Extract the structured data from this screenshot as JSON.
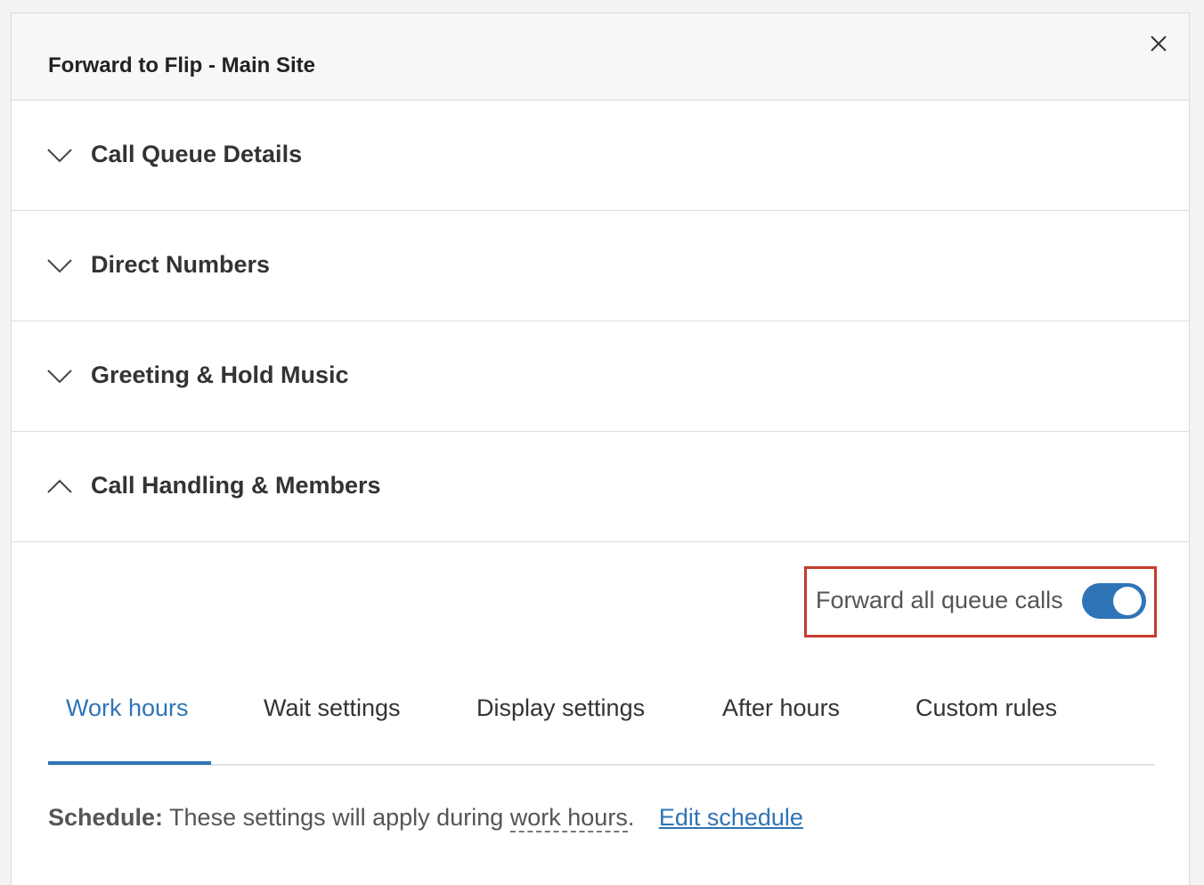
{
  "panel": {
    "title": "Forward to Flip - Main Site",
    "close_icon": "close-icon"
  },
  "sections": [
    {
      "label": "Call Queue Details",
      "expanded": false,
      "icon": "chevron-down-icon"
    },
    {
      "label": "Direct Numbers",
      "expanded": false,
      "icon": "chevron-down-icon"
    },
    {
      "label": "Greeting & Hold Music",
      "expanded": false,
      "icon": "chevron-down-icon"
    },
    {
      "label": "Call Handling & Members",
      "expanded": true,
      "icon": "chevron-up-icon"
    }
  ],
  "forward": {
    "label": "Forward all queue calls",
    "enabled": true,
    "highlight_color": "#c43c2d"
  },
  "tabs": [
    {
      "label": "Work hours",
      "active": true
    },
    {
      "label": "Wait settings",
      "active": false
    },
    {
      "label": "Display settings",
      "active": false
    },
    {
      "label": "After hours",
      "active": false
    },
    {
      "label": "Custom rules",
      "active": false
    }
  ],
  "schedule": {
    "label": "Schedule:",
    "text": "These settings will apply during",
    "work_hours": "work hours",
    "period": ".",
    "edit_link": "Edit schedule"
  },
  "colors": {
    "accent": "#2f74b6",
    "toggle_on": "#2f74b6"
  }
}
